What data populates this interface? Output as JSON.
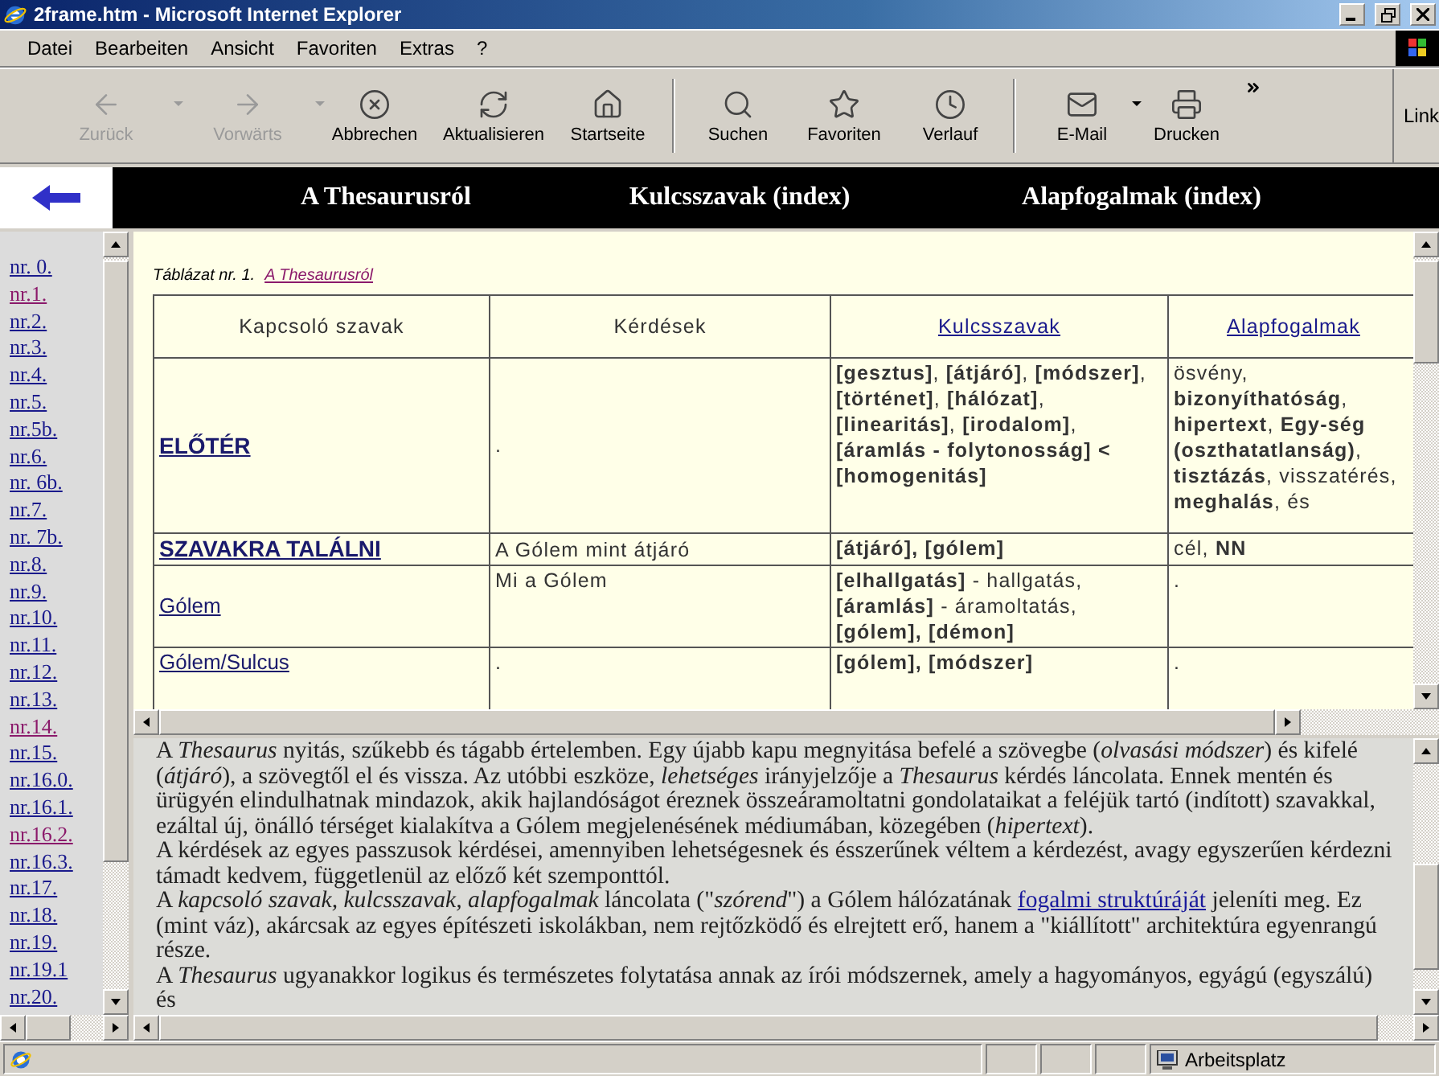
{
  "window": {
    "title": "2frame.htm - Microsoft Internet Explorer"
  },
  "menu": [
    "Datei",
    "Bearbeiten",
    "Ansicht",
    "Favoriten",
    "Extras",
    "?"
  ],
  "toolbar": [
    {
      "kind": "back",
      "label": "Zurück",
      "disabled": true,
      "dropdown": true
    },
    {
      "kind": "forward",
      "label": "Vorwärts",
      "disabled": true,
      "dropdown": true
    },
    {
      "kind": "stop",
      "label": "Abbrechen",
      "disabled": false,
      "dropdown": false
    },
    {
      "kind": "refresh",
      "label": "Aktualisieren",
      "disabled": false,
      "dropdown": false
    },
    {
      "kind": "home",
      "label": "Startseite",
      "disabled": false,
      "dropdown": false
    },
    {
      "kind": "separator"
    },
    {
      "kind": "search",
      "label": "Suchen",
      "disabled": false,
      "dropdown": false
    },
    {
      "kind": "favorites",
      "label": "Favoriten",
      "disabled": false,
      "dropdown": false
    },
    {
      "kind": "history",
      "label": "Verlauf",
      "disabled": false,
      "dropdown": false
    },
    {
      "kind": "separator"
    },
    {
      "kind": "mail",
      "label": "E-Mail",
      "disabled": false,
      "dropdown": true
    },
    {
      "kind": "print",
      "label": "Drucken",
      "disabled": false,
      "dropdown": false
    }
  ],
  "links_label": "Link",
  "banner": {
    "links": [
      "A Thesaurusról",
      "Kulcsszavak (index)",
      "Alapfogalmak (index)"
    ]
  },
  "sidebar": {
    "items": [
      {
        "label": "nr. 0.",
        "visited": false
      },
      {
        "label": "nr.1.",
        "visited": true
      },
      {
        "label": "nr.2.",
        "visited": false
      },
      {
        "label": "nr.3.",
        "visited": false
      },
      {
        "label": "nr.4.",
        "visited": false
      },
      {
        "label": "nr.5.",
        "visited": false
      },
      {
        "label": "nr.5b.",
        "visited": false
      },
      {
        "label": "nr.6.",
        "visited": false
      },
      {
        "label": "nr. 6b.",
        "visited": false
      },
      {
        "label": "nr.7.",
        "visited": false
      },
      {
        "label": "nr. 7b.",
        "visited": false
      },
      {
        "label": "nr.8.",
        "visited": false
      },
      {
        "label": "nr.9.",
        "visited": false
      },
      {
        "label": "nr.10.",
        "visited": false
      },
      {
        "label": "nr.11.",
        "visited": false
      },
      {
        "label": "nr.12.",
        "visited": false
      },
      {
        "label": "nr.13.",
        "visited": false
      },
      {
        "label": "nr.14.",
        "visited": true
      },
      {
        "label": "nr.15.",
        "visited": false
      },
      {
        "label": "nr.16.0.",
        "visited": false
      },
      {
        "label": "nr.16.1.",
        "visited": false
      },
      {
        "label": "nr.16.2.",
        "visited": true
      },
      {
        "label": "nr.16.3.",
        "visited": false
      },
      {
        "label": "nr.17.",
        "visited": false
      },
      {
        "label": "nr.18.",
        "visited": false
      },
      {
        "label": "nr.19.",
        "visited": false
      },
      {
        "label": "nr.19.1",
        "visited": false
      },
      {
        "label": "nr.20.",
        "visited": false
      }
    ]
  },
  "table": {
    "caption": "Táblázat nr. 1.",
    "caption_link": {
      "text": "A Thesaurusról",
      "visited": true
    },
    "columns": [
      {
        "label": "Kapcsoló szavak",
        "link": false
      },
      {
        "label": "Kérdések",
        "link": false
      },
      {
        "label": "Kulcsszavak",
        "link": true
      },
      {
        "label": "Alapfogalmak",
        "link": true
      }
    ],
    "rows": [
      {
        "term": "ELŐTÉR",
        "bold": true,
        "question": ".",
        "keywords": "**[gesztus]**, **[átjáró]**, **[módszer]**, **[történet]**, **[hálózat]**, **[linearitás]**, **[irodalom]**, **[áramlás - folytonosság] < [homogenitás]**",
        "concepts": "ösvény, **bizonyíthatóság**, **hipertext**, **Egy-ség (oszthatatlanság)**, **tisztázás**, visszatérés, **meghalás**, és"
      },
      {
        "term": "SZAVAKRA TALÁLNI",
        "bold": true,
        "question": "A Gólem mint átjáró",
        "keywords": "**[átjáró], [gólem]**",
        "concepts": "cél, **NN**"
      },
      {
        "term": "Gólem",
        "bold": false,
        "question": "Mi a Gólem",
        "keywords": "**[elhallgatás]** - hallgatás, **[áramlás]** - áramoltatás, **[gólem], [démon]**",
        "concepts": "."
      },
      {
        "term": "Gólem/Sulcus",
        "bold": false,
        "question": ".",
        "keywords": "**[gólem], [módszer]**",
        "concepts": "."
      }
    ]
  },
  "article": {
    "paragraphs": [
      [
        {
          "text": "A *Thesaurus* nyitás, szűkebb és tágabb értelemben. Egy újabb kapu megnyitása befelé a szövegbe (*olvasási módszer*) és kifelé (*átjáró*), a szövegtől el és vissza. Az utóbbi eszköze, *lehetséges* irányjelzője a *Thesaurus* kérdés láncolata. Ennek mentén és ürügyén elindulhatnak mindazok, akik hajlandóságot éreznek összeáramoltatni gondolataikat a feléjük tartó (indított) szavakkal, ezáltal új, önálló térséget kialakítva a Gólem megjelenésének médiumában, közegében (*hipertext*).",
          "link": false
        }
      ],
      [
        {
          "text": "A kérdések az egyes passzusok kérdései, amennyiben lehetségesnek és ésszerűnek véltem a kérdezést, avagy egyszerűen kérdezni támadt kedvem, függetlenül az előző két szemponttól.",
          "link": false
        }
      ],
      [
        {
          "text": "A *kapcsoló szavak, kulcsszavak, alapfogalmak* láncolata (\"*szórend*\") a Gólem hálózatának ",
          "link": false
        },
        {
          "text": "fogalmi struktúráját",
          "link": true
        },
        {
          "text": " jeleníti meg. Ez (mint váz), akárcsak az egyes építészeti iskolákban, nem rejtőzködő és elrejtett erő, hanem a \"kiállított\" architektúra egyenrangú része.",
          "link": false
        }
      ],
      [
        {
          "text": "A *Thesaurus* ugyanakkor logikus és természetes folytatása annak az írói módszernek, amely a hagyományos, egyágú (egyszálú) és",
          "link": false
        }
      ]
    ]
  },
  "status_bar": {
    "zone": "Arbeitsplatz"
  }
}
